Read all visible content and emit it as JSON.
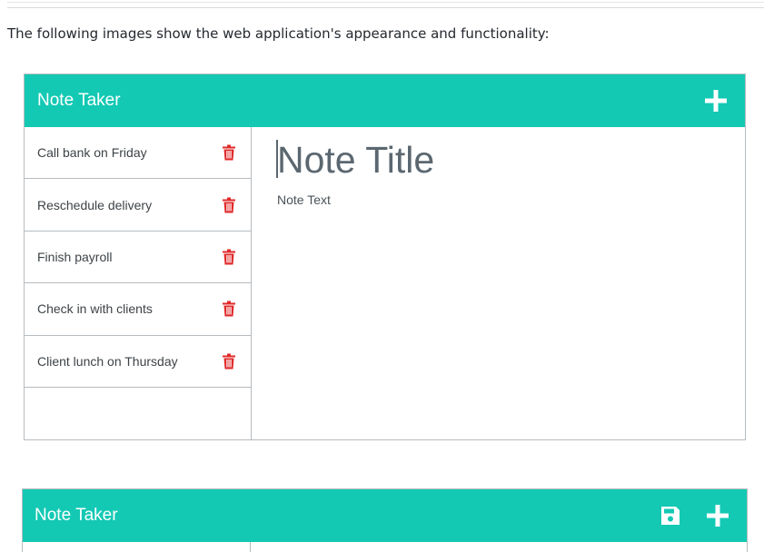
{
  "intro_text": "The following images show the web application's appearance and functionality:",
  "screenshot1": {
    "navbar": {
      "brand": "Note Taker",
      "new_note_icon": "plus-icon"
    },
    "notes": [
      {
        "title": "Call bank on Friday",
        "delete_icon": "trash-icon"
      },
      {
        "title": "Reschedule delivery",
        "delete_icon": "trash-icon"
      },
      {
        "title": "Finish payroll",
        "delete_icon": "trash-icon"
      },
      {
        "title": "Check in with clients",
        "delete_icon": "trash-icon"
      },
      {
        "title": "Client lunch on Thursday",
        "delete_icon": "trash-icon"
      }
    ],
    "editor": {
      "title_placeholder": "Note Title",
      "text_placeholder": "Note Text"
    }
  },
  "screenshot2": {
    "navbar": {
      "brand": "Note Taker",
      "save_icon": "save-icon",
      "new_note_icon": "plus-icon"
    }
  },
  "colors": {
    "navbar": "#13c9b4",
    "trash": "#e02a2a",
    "border": "#b6bcc0",
    "title_text": "#5b6770"
  }
}
